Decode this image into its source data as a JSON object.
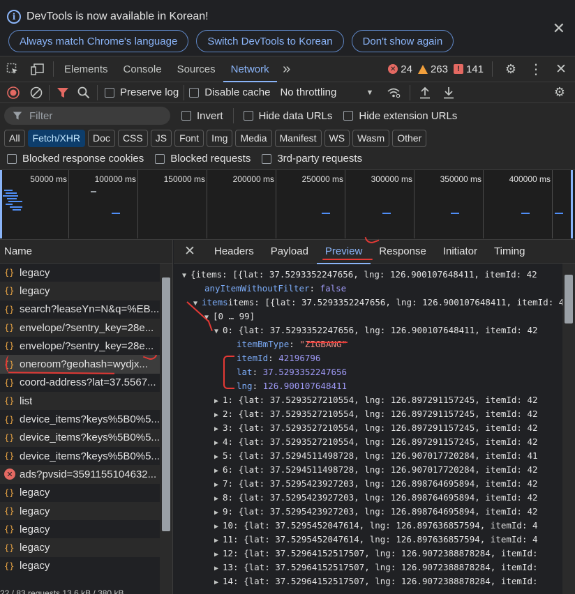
{
  "infobar": {
    "message": "DevTools is now available in Korean!",
    "buttons": [
      "Always match Chrome's language",
      "Switch DevTools to Korean",
      "Don't show again"
    ]
  },
  "tabs": [
    "Elements",
    "Console",
    "Sources",
    "Network"
  ],
  "active_tab": "Network",
  "counts": {
    "errors": "24",
    "warnings": "263",
    "issues": "141"
  },
  "toolbar": {
    "preserve_log": "Preserve log",
    "disable_cache": "Disable cache",
    "throttling": "No throttling"
  },
  "filter": {
    "placeholder": "Filter",
    "invert": "Invert",
    "hide_data": "Hide data URLs",
    "hide_ext": "Hide extension URLs"
  },
  "types": [
    "All",
    "Fetch/XHR",
    "Doc",
    "CSS",
    "JS",
    "Font",
    "Img",
    "Media",
    "Manifest",
    "WS",
    "Wasm",
    "Other"
  ],
  "active_type": "Fetch/XHR",
  "blocked": {
    "cookies": "Blocked response cookies",
    "requests": "Blocked requests",
    "third_party": "3rd-party requests"
  },
  "overview_labels": [
    "50000 ms",
    "100000 ms",
    "150000 ms",
    "200000 ms",
    "250000 ms",
    "300000 ms",
    "350000 ms",
    "400000 ms"
  ],
  "name_header": "Name",
  "requests": [
    {
      "name": "legacy",
      "err": false
    },
    {
      "name": "legacy",
      "err": false
    },
    {
      "name": "search?leaseYn=N&q=%EB...",
      "err": false
    },
    {
      "name": "envelope/?sentry_key=28e...",
      "err": false
    },
    {
      "name": "envelope/?sentry_key=28e...",
      "err": false
    },
    {
      "name": "oneroom?geohash=wydjx...",
      "err": false
    },
    {
      "name": "coord-address?lat=37.5567...",
      "err": false
    },
    {
      "name": "list",
      "err": false
    },
    {
      "name": "device_items?keys%5B0%5...",
      "err": false
    },
    {
      "name": "device_items?keys%5B0%5...",
      "err": false
    },
    {
      "name": "device_items?keys%5B0%5...",
      "err": false
    },
    {
      "name": "ads?pvsid=3591155104632...",
      "err": true
    },
    {
      "name": "legacy",
      "err": false
    },
    {
      "name": "legacy",
      "err": false
    },
    {
      "name": "legacy",
      "err": false
    },
    {
      "name": "legacy",
      "err": false
    },
    {
      "name": "legacy",
      "err": false
    }
  ],
  "status": "22 / 83 requests   13.6 kB / 380 kB",
  "detail_tabs": [
    "Headers",
    "Payload",
    "Preview",
    "Response",
    "Initiator",
    "Timing"
  ],
  "active_detail_tab": "Preview",
  "preview": {
    "root": "{items: [{lat: 37.5293352247656, lng: 126.900107648411, itemId: 42",
    "anyItem_key": "anyItemWithoutFilter",
    "anyItem_val": "false",
    "items_line": "items: [{lat: 37.5293352247656, lng: 126.900107648411, itemId: 4",
    "range": "[0 … 99]",
    "item0": "0: {lat: 37.5293352247656, lng: 126.900107648411, itemId: 42",
    "itemBmType_key": "itemBmType",
    "itemBmType_val": "\"ZIGBANG\"",
    "itemId_key": "itemId",
    "itemId_val": "42196796",
    "lat_key": "lat",
    "lat_val": "37.5293352247656",
    "lng_key": "lng",
    "lng_val": "126.900107648411",
    "rows": [
      "1: {lat: 37.5293527210554, lng: 126.897291157245, itemId: 42",
      "2: {lat: 37.5293527210554, lng: 126.897291157245, itemId: 42",
      "3: {lat: 37.5293527210554, lng: 126.897291157245, itemId: 42",
      "4: {lat: 37.5293527210554, lng: 126.897291157245, itemId: 42",
      "5: {lat: 37.5294511498728, lng: 126.907017720284, itemId: 41",
      "6: {lat: 37.5294511498728, lng: 126.907017720284, itemId: 42",
      "7: {lat: 37.5295423927203, lng: 126.898764695894, itemId: 42",
      "8: {lat: 37.5295423927203, lng: 126.898764695894, itemId: 42",
      "9: {lat: 37.5295423927203, lng: 126.898764695894, itemId: 42",
      "10: {lat: 37.5295452047614, lng: 126.897636857594, itemId: 4",
      "11: {lat: 37.5295452047614, lng: 126.897636857594, itemId: 4",
      "12: {lat: 37.52964152517507, lng: 126.9072388878284, itemId:",
      "13: {lat: 37.52964152517507, lng: 126.9072388878284, itemId:",
      "14: {lat: 37.52964152517507, lng: 126.9072388878284, itemId:"
    ]
  }
}
